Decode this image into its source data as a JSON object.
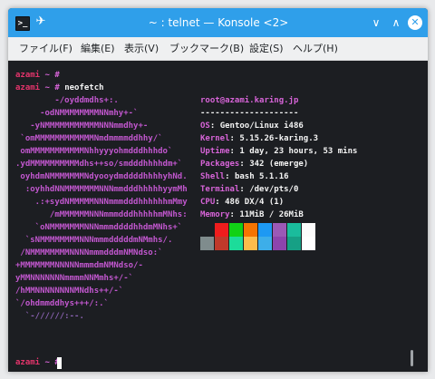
{
  "window": {
    "title": "~ : telnet — Konsole <2>",
    "app_icon_glyph": ">_",
    "pin_glyph": "✈",
    "minimize_glyph": "∨",
    "maximize_glyph": "∧",
    "close_glyph": "✕",
    "accent_color": "#2f9fea"
  },
  "menu": {
    "items": [
      "ファイル(F)",
      "編集(E)",
      "表示(V)",
      "ブックマーク(B)",
      "設定(S)",
      "ヘルプ(H)"
    ]
  },
  "terminal": {
    "prompt_user": "azami",
    "prompt_tail": " ~ #",
    "command": " neofetch",
    "logo_lines": [
      "        -/oyddmdhs+:.",
      "     -odNMMMMMMMMNNmhy+-`",
      "   -yNMMMMMMMMMMMNNNmmdhy+-",
      " `omMMMMMMMMMMMMNmdmmmmddhhy/`",
      " omMMMMMMMMMMMNhhyyyohmdddhhhdo`",
      ".ydMMMMMMMMMMdhs++so/smdddhhhhdm+`",
      " oyhdmNMMMMMMMNdyooydmddddhhhhyhNd.",
      "  :oyhhdNNMMMMMMMNNNmmdddhhhhhyymMh",
      "    .:+sydNMMMMMNNNmmmdddhhhhhhmMmy",
      "       /mMMMMMMNNNmmmdddhhhhhmMNhs:",
      "    `oNMMMMMMMNNNmmmddddhhdmMNhs+`",
      "  `sNMMMMMMMMNNNmmmdddddmNMmhs/.",
      " /NMMMMMMMMNNNNmmmdddmNMNdso:`",
      "+MMMMMMMNNNNNmmmdmNMNdso/-",
      "yMMNNNNNNNmmmmNNMmhs+/-`",
      "/hMMNNNNNNNNMNdhs++/-`",
      "`/ohdmmddhys+++/:.`",
      "  `-//////:--."
    ],
    "info": {
      "user_host": "root@azami.karing.jp",
      "separator": "--------------------",
      "rows": [
        {
          "key": "OS",
          "value": "Gentoo/Linux i486"
        },
        {
          "key": "Kernel",
          "value": "5.15.26-karing.3"
        },
        {
          "key": "Uptime",
          "value": "1 day, 23 hours, 53 mins"
        },
        {
          "key": "Packages",
          "value": "342 (emerge)"
        },
        {
          "key": "Shell",
          "value": "bash 5.1.16"
        },
        {
          "key": "Terminal",
          "value": "/dev/pts/0"
        },
        {
          "key": "CPU",
          "value": "486 DX/4 (1)"
        },
        {
          "key": "Memory",
          "value": "11MiB / 26MiB"
        }
      ],
      "key_sep": ":"
    },
    "palette_top": [
      "#1c1e22",
      "#ef1d1d",
      "#11d116",
      "#f67400",
      "#1d99f3",
      "#9b59b6",
      "#1abc9c",
      "#fcfcfc"
    ],
    "palette_bottom": [
      "#7f8c8d",
      "#c0392b",
      "#1cdc9a",
      "#fdbc4b",
      "#3daee9",
      "#8e44ad",
      "#16a085",
      "#ffffff"
    ]
  }
}
